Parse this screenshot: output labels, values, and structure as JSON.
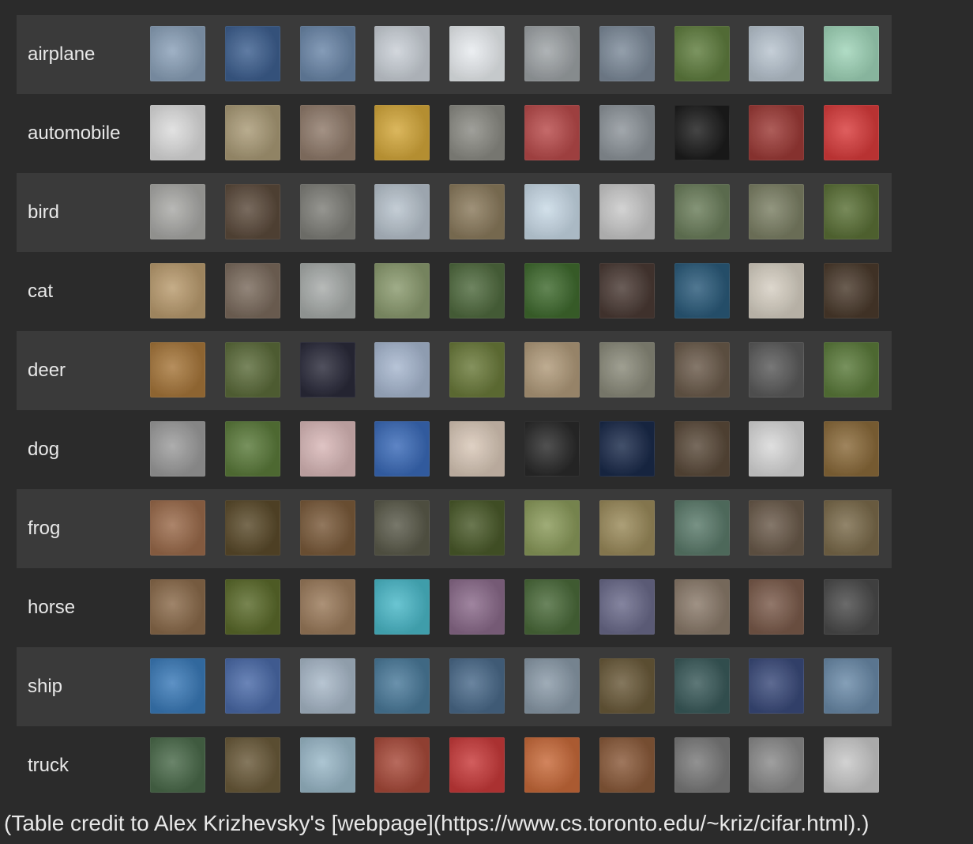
{
  "caption": "(Table credit to Alex Krizhevsky's [webpage](https://www.cs.toronto.edu/~kriz/cifar.html).)",
  "classes": [
    {
      "label": "airplane",
      "thumbs": [
        "#8aa0b8",
        "#3d5f8f",
        "#6a86a8",
        "#c9cfd6",
        "#e8ecef",
        "#9ea3a6",
        "#7c8a99",
        "#5f7d3e",
        "#b8c4cf",
        "#9fd4b8"
      ]
    },
    {
      "label": "automobile",
      "thumbs": [
        "#dcdcdc",
        "#a99a76",
        "#8f7a6a",
        "#d3a73a",
        "#8b8b84",
        "#b84a4a",
        "#8d949a",
        "#1c1c1c",
        "#9c3a36",
        "#d83b3b"
      ]
    },
    {
      "label": "bird",
      "thumbs": [
        "#a9a9a6",
        "#5b4a3b",
        "#7e7e78",
        "#b7c2cc",
        "#8a7a5c",
        "#c8d9e6",
        "#c9c9c9",
        "#6a7d5a",
        "#7b7f64",
        "#5a7036"
      ]
    },
    {
      "label": "cat",
      "thumbs": [
        "#b99b6e",
        "#7a6a5c",
        "#a7aba9",
        "#8a9a6e",
        "#4f6a3e",
        "#3f6a2e",
        "#4a3a34",
        "#2a5a7a",
        "#d6cfc2",
        "#4a3a2c"
      ]
    },
    {
      "label": "deer",
      "thumbs": [
        "#a6763a",
        "#5b6b3a",
        "#2a2a3a",
        "#a7b7cf",
        "#6a7a3a",
        "#b09a7a",
        "#8a8a7a",
        "#6a5a4a",
        "#5a5a5a",
        "#5a7a3a"
      ]
    },
    {
      "label": "dog",
      "thumbs": [
        "#9c9c9c",
        "#5a7a3a",
        "#d8b7b7",
        "#3a6ab8",
        "#d8c7b7",
        "#2a2a2a",
        "#1a2a4a",
        "#5a4a3a",
        "#d8d8d8",
        "#8a6a3a"
      ]
    },
    {
      "label": "frog",
      "thumbs": [
        "#9a6a4a",
        "#5a4a2a",
        "#7a5a3a",
        "#5a5a4a",
        "#4a5a2a",
        "#8a9a5a",
        "#9a8a5a",
        "#5a7a6a",
        "#6a5a4a",
        "#7a6a4a"
      ]
    },
    {
      "label": "horse",
      "thumbs": [
        "#8a6a4a",
        "#5a6a2a",
        "#9a7a5a",
        "#4ab8c8",
        "#8a6a8a",
        "#4a6a3a",
        "#6a6a8a",
        "#8a7a6a",
        "#7a5a4a",
        "#4a4a4a"
      ]
    },
    {
      "label": "ship",
      "thumbs": [
        "#3a7ab8",
        "#4a6aa8",
        "#a8b8c8",
        "#4a7a9a",
        "#4a6a8a",
        "#8a9aa8",
        "#6a5a3a",
        "#3a5a5a",
        "#3a4a7a",
        "#6a8aa8"
      ]
    },
    {
      "label": "truck",
      "thumbs": [
        "#4a6a4a",
        "#6a5a3a",
        "#9ab8c8",
        "#a84a3a",
        "#c83a3a",
        "#c86a3a",
        "#8a5a3a",
        "#7a7a7a",
        "#8a8a8a",
        "#c8c8c8"
      ]
    }
  ]
}
